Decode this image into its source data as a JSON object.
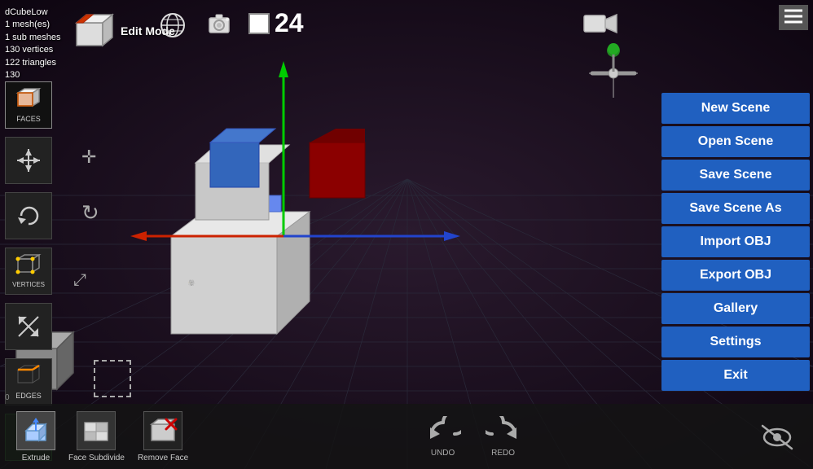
{
  "info": {
    "name": "dCubeLow",
    "meshes": "1 mesh(es)",
    "sub_meshes": "1 sub meshes",
    "vertices": "130 vertices",
    "triangles": "122 triangles",
    "misc": "130"
  },
  "mode": {
    "label": "Edit Mode"
  },
  "frame": {
    "count": "24"
  },
  "status_bar": {
    "value": "0"
  },
  "menu": {
    "new_scene": "New Scene",
    "open_scene": "Open Scene",
    "save_scene": "Save Scene",
    "save_scene_as": "Save Scene As",
    "import_obj": "Import OBJ",
    "export_obj": "Export OBJ",
    "gallery": "Gallery",
    "settings": "Settings",
    "exit": "Exit"
  },
  "left_sidebar": {
    "faces_label": "FACES",
    "vertices_label": "VERTICES",
    "edges_label": "EDGES",
    "add_label": "+"
  },
  "bottom_tools": {
    "extrude_label": "Extrude",
    "face_subdivide_label": "Face Subdivide",
    "remove_face_label": "Remove Face",
    "undo_label": "UNDO",
    "redo_label": "REDO"
  }
}
